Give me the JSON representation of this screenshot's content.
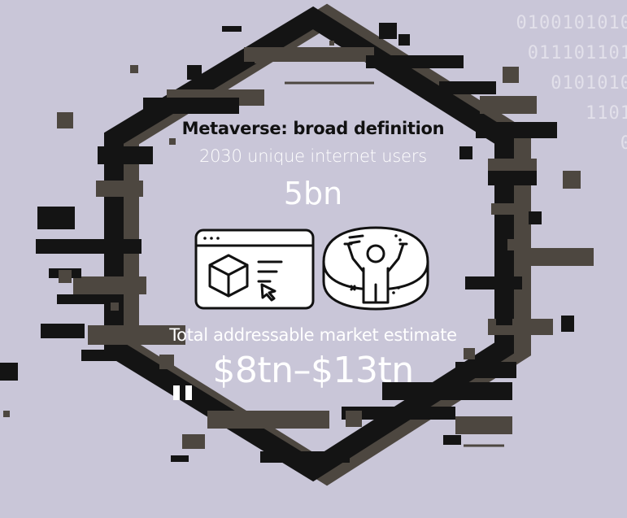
{
  "colors": {
    "background": "#c9c6d8",
    "frame_dark": "#141414",
    "frame_shadow": "#4d4740",
    "text_white": "#ffffff",
    "text_dark": "#111111",
    "binary_text": "#e2e0ea"
  },
  "binary_lines": [
    "0100101010",
    "011101101",
    "0101010",
    "1101",
    "0"
  ],
  "heading": {
    "title": "Metaverse: broad definition",
    "users_label": "2030 unique internet users",
    "users_value": "5bn"
  },
  "icons": {
    "left": "browser-window-cube-cursor-icon",
    "right": "person-vr-immersive-screen-icon"
  },
  "market": {
    "label": "Total addressable market estimate",
    "value": "$8tn–$13tn"
  }
}
